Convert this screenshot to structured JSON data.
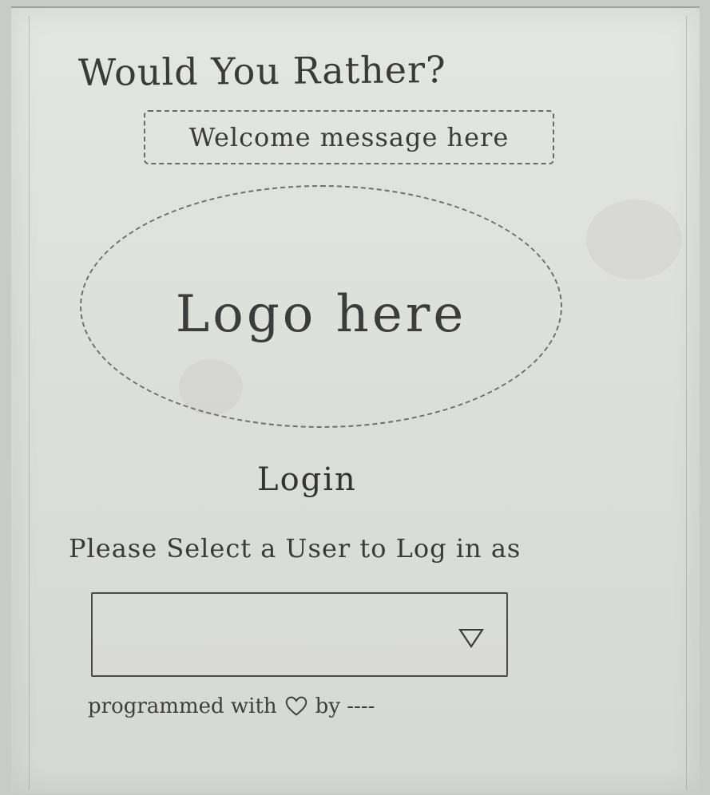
{
  "header": {
    "title": "Would You Rather?",
    "welcome": "Welcome message here"
  },
  "logo": {
    "placeholder": "Logo here"
  },
  "login": {
    "heading": "Login",
    "prompt": "Please Select a User to Log in as",
    "user_select": {
      "selected_value": "",
      "icon": "chevron-down-icon"
    }
  },
  "footer": {
    "prefix": "programmed with",
    "icon": "heart-icon",
    "suffix": "by ----"
  }
}
